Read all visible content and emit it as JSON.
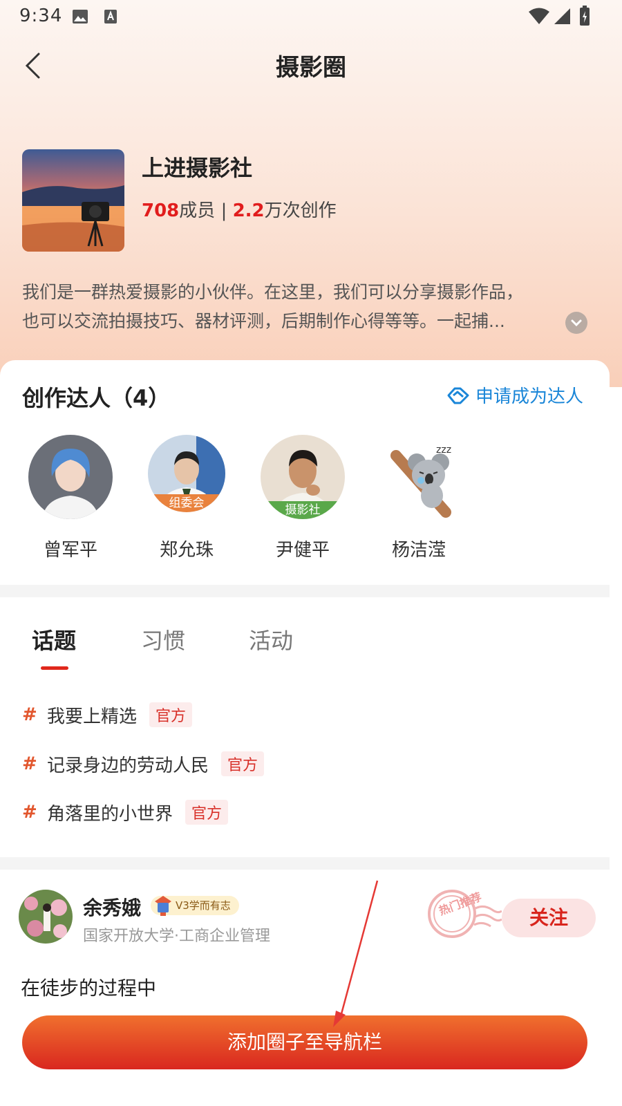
{
  "status_bar": {
    "time": "9:34"
  },
  "nav": {
    "title": "摄影圈"
  },
  "circle": {
    "name": "上进摄影社",
    "members_count": "708",
    "members_label": "成员",
    "separator": "|",
    "creations_count": "2.2",
    "creations_label": "万次创作",
    "description_line1": "我们是一群热爱摄影的小伙伴。在这里，我们可以分享摄影作品，",
    "description_line2": "也可以交流拍摄技巧、器材评测，后期制作心得等等。一起捕..."
  },
  "talents": {
    "title": "创作达人（4）",
    "apply_label": "申请成为达人",
    "people": [
      {
        "name": "曾军平",
        "tag": ""
      },
      {
        "name": "郑允珠",
        "tag": "组委会"
      },
      {
        "name": "尹健平",
        "tag": "摄影社"
      },
      {
        "name": "杨洁滢",
        "tag": ""
      }
    ]
  },
  "tabs": [
    {
      "label": "话题",
      "active": true
    },
    {
      "label": "习惯",
      "active": false
    },
    {
      "label": "活动",
      "active": false
    }
  ],
  "topics": [
    {
      "hash": "#",
      "title": "我要上精选",
      "badge": "官方"
    },
    {
      "hash": "#",
      "title": "记录身边的劳动人民",
      "badge": "官方"
    },
    {
      "hash": "#",
      "title": "角落里的小世界",
      "badge": "官方"
    }
  ],
  "post": {
    "user": "余秀娥",
    "level": "V3学而有志",
    "school": "国家开放大学·工商企业管理",
    "stamp_text": "热门推荐",
    "follow_label": "关注",
    "text": "在徒步的过程中"
  },
  "cta": {
    "label": "添加圈子至导航栏"
  },
  "colors": {
    "accent": "#e0281c",
    "link": "#1a86d8",
    "cta_start": "#f0702e",
    "cta_end": "#d9271f"
  }
}
